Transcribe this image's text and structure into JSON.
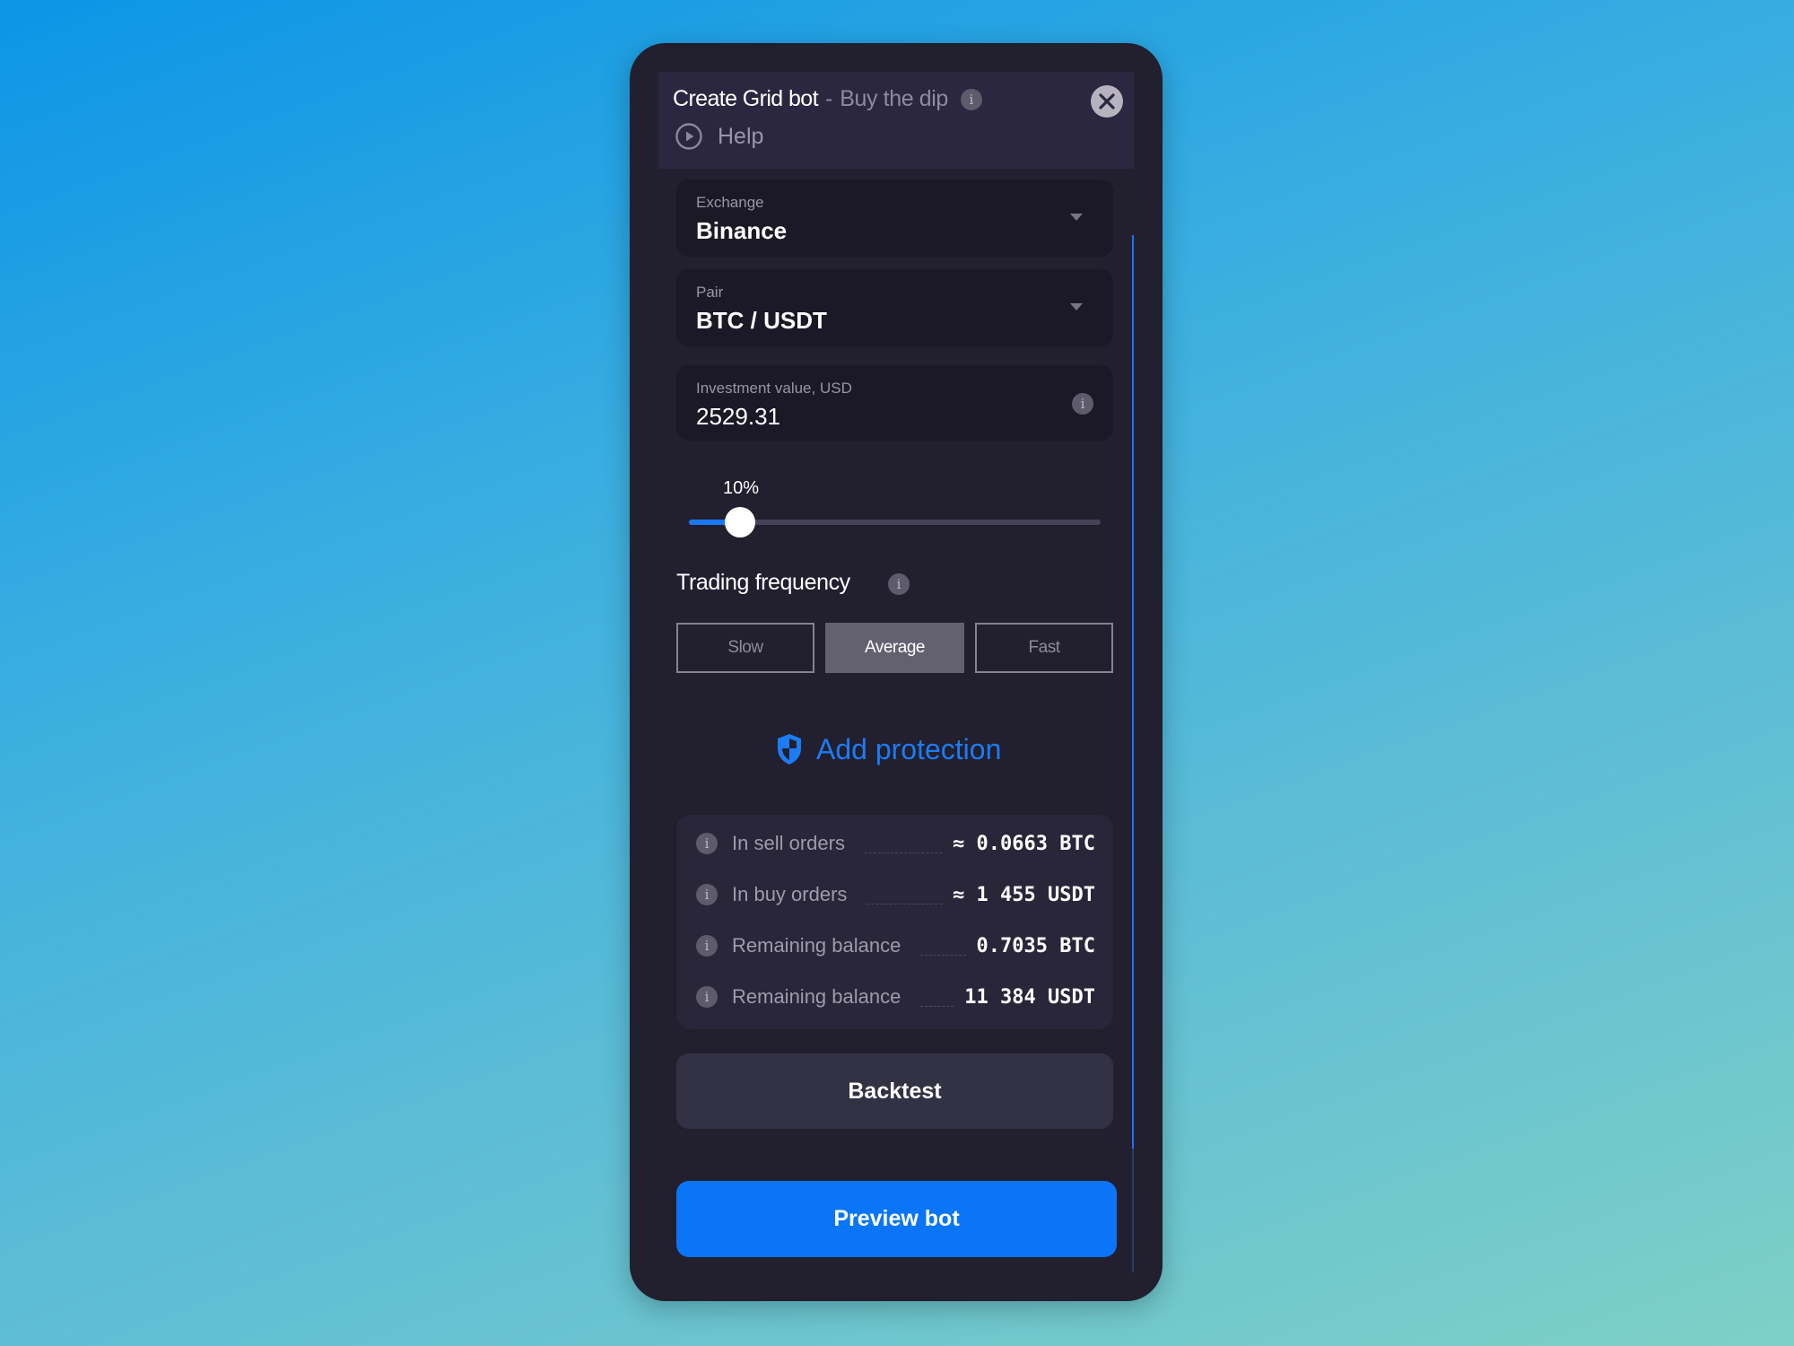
{
  "header": {
    "title": "Create Grid bot",
    "separator": "-",
    "subtitle": "Buy the dip",
    "info_icon": "info-icon",
    "close_icon": "close-icon",
    "help_label": "Help",
    "help_icon": "play-circle-icon"
  },
  "form": {
    "exchange": {
      "label": "Exchange",
      "value": "Binance"
    },
    "pair": {
      "label": "Pair",
      "value": "BTC / USDT"
    },
    "investment": {
      "label": "Investment value, USD",
      "value": "2529.31"
    }
  },
  "slider": {
    "label": "10%",
    "value_percent": 10
  },
  "trading_frequency": {
    "label": "Trading frequency",
    "options": [
      {
        "label": "Slow",
        "selected": false
      },
      {
        "label": "Average",
        "selected": true
      },
      {
        "label": "Fast",
        "selected": false
      }
    ]
  },
  "protection": {
    "label": "Add protection",
    "icon": "shield-icon"
  },
  "summary": {
    "rows": [
      {
        "label": "In sell orders",
        "value": "≈ 0.0663 BTC"
      },
      {
        "label": "In buy orders",
        "value": "≈ 1 455 USDT"
      },
      {
        "label": "Remaining balance",
        "value": "0.7035 BTC"
      },
      {
        "label": "Remaining balance",
        "value": "11 384 USDT"
      }
    ]
  },
  "actions": {
    "backtest": "Backtest",
    "preview": "Preview bot"
  },
  "colors": {
    "accent": "#0a75f6",
    "card_bg": "#221f2e",
    "header_bg": "#2b2740"
  }
}
